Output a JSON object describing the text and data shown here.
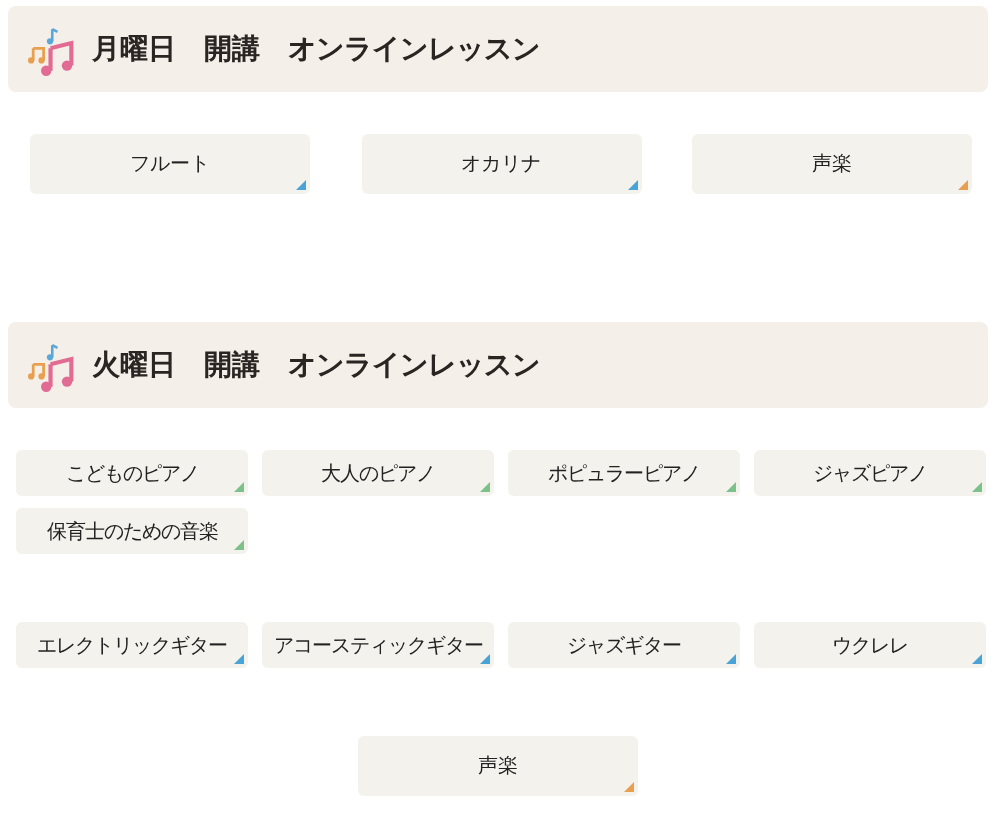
{
  "sections": [
    {
      "title": "月曜日　開講　オンラインレッスン",
      "groups": [
        {
          "kind": "large",
          "buttons": [
            {
              "label": "フルート",
              "color": "#4aa3d6"
            },
            {
              "label": "オカリナ",
              "color": "#4aa3d6"
            },
            {
              "label": "声楽",
              "color": "#e8a050"
            }
          ]
        }
      ]
    },
    {
      "title": "火曜日　開講　オンラインレッスン",
      "groups": [
        {
          "kind": "small",
          "buttons": [
            {
              "label": "こどものピアノ",
              "color": "#7cc08a"
            },
            {
              "label": "大人のピアノ",
              "color": "#7cc08a"
            },
            {
              "label": "ポピュラーピアノ",
              "color": "#7cc08a"
            },
            {
              "label": "ジャズピアノ",
              "color": "#7cc08a"
            },
            {
              "label": "保育士のための音楽",
              "color": "#7cc08a"
            }
          ]
        },
        {
          "kind": "small",
          "buttons": [
            {
              "label": "エレクトリックギター",
              "color": "#4aa3d6"
            },
            {
              "label": "アコースティックギター",
              "color": "#4aa3d6"
            },
            {
              "label": "ジャズギター",
              "color": "#4aa3d6"
            },
            {
              "label": "ウクレレ",
              "color": "#4aa3d6"
            }
          ]
        },
        {
          "kind": "single",
          "buttons": [
            {
              "label": "声楽",
              "color": "#e8a050"
            }
          ]
        }
      ]
    }
  ]
}
